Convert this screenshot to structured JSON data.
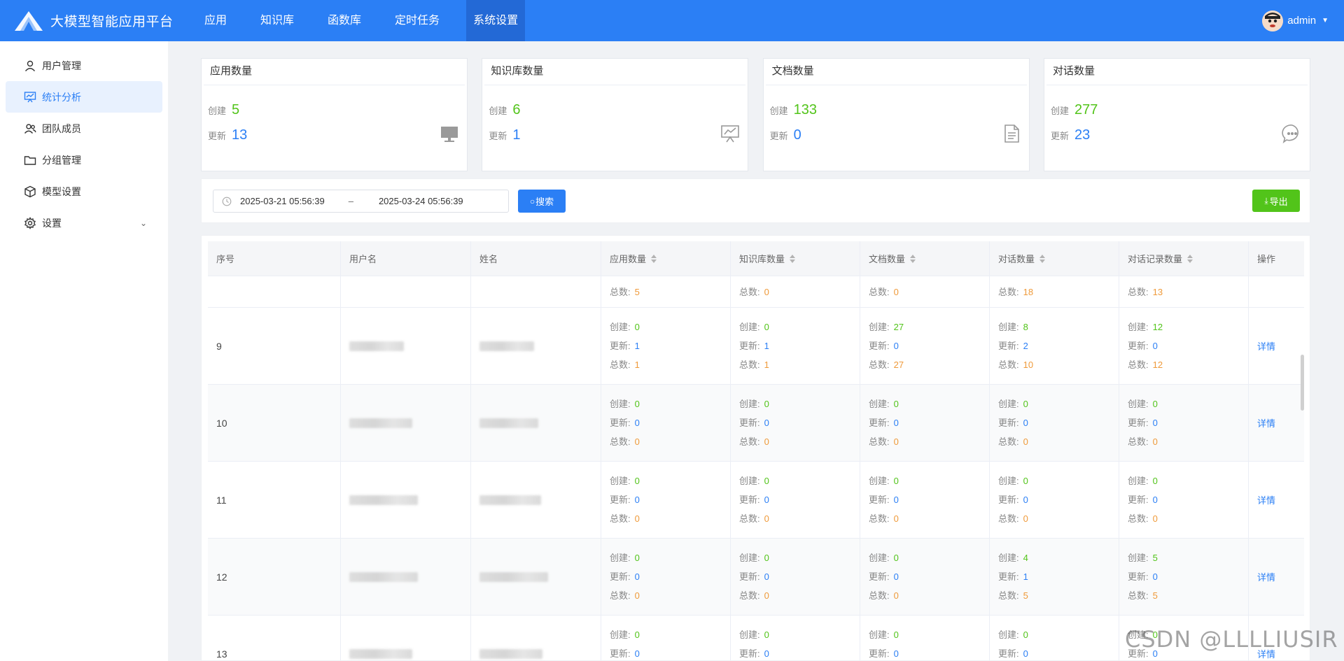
{
  "app": {
    "title": "大模型智能应用平台"
  },
  "nav": [
    {
      "label": "应用"
    },
    {
      "label": "知识库"
    },
    {
      "label": "函数库"
    },
    {
      "label": "定时任务"
    },
    {
      "label": "系统设置"
    }
  ],
  "user": {
    "name": "admin"
  },
  "sidebar": {
    "items": [
      {
        "label": "用户管理",
        "icon": "user-icon"
      },
      {
        "label": "统计分析",
        "icon": "chart-board-icon"
      },
      {
        "label": "团队成员",
        "icon": "team-icon"
      },
      {
        "label": "分组管理",
        "icon": "folder-icon"
      },
      {
        "label": "模型设置",
        "icon": "cube-icon"
      },
      {
        "label": "设置",
        "icon": "gear-icon"
      }
    ]
  },
  "colors": {
    "header": "#2b7ff5",
    "green": "#52c41a",
    "blue": "#2b7ff5",
    "orange": "#ef9a3a"
  },
  "labels": {
    "create": "创建",
    "update": "更新",
    "total": "总数:",
    "create_colon": "创建:",
    "update_colon": "更新:"
  },
  "cards": [
    {
      "title": "应用数量",
      "create": "5",
      "update": "13",
      "icon": "monitor-icon"
    },
    {
      "title": "知识库数量",
      "create": "6",
      "update": "1",
      "icon": "presentation-icon"
    },
    {
      "title": "文档数量",
      "create": "133",
      "update": "0",
      "icon": "document-icon"
    },
    {
      "title": "对话数量",
      "create": "277",
      "update": "23",
      "icon": "chat-icon"
    }
  ],
  "filter": {
    "start": "2025-03-21 05:56:39",
    "separator": "–",
    "end": "2025-03-24 05:56:39",
    "search_label": "搜索",
    "export_label": "导出"
  },
  "table": {
    "headers": [
      "序号",
      "用户名",
      "姓名",
      "应用数量",
      "知识库数量",
      "文档数量",
      "对话数量",
      "对话记录数量",
      "操作"
    ],
    "partial_totals": [
      "5",
      "0",
      "0",
      "18",
      "13"
    ],
    "rows": [
      {
        "index": "9",
        "create": [
          "0",
          "0",
          "27",
          "8",
          "12"
        ],
        "update": [
          "1",
          "1",
          "0",
          "2",
          "0"
        ],
        "total": [
          "1",
          "1",
          "27",
          "10",
          "12"
        ]
      },
      {
        "index": "10",
        "create": [
          "0",
          "0",
          "0",
          "0",
          "0"
        ],
        "update": [
          "0",
          "0",
          "0",
          "0",
          "0"
        ],
        "total": [
          "0",
          "0",
          "0",
          "0",
          "0"
        ]
      },
      {
        "index": "11",
        "create": [
          "0",
          "0",
          "0",
          "0",
          "0"
        ],
        "update": [
          "0",
          "0",
          "0",
          "0",
          "0"
        ],
        "total": [
          "0",
          "0",
          "0",
          "0",
          "0"
        ]
      },
      {
        "index": "12",
        "create": [
          "0",
          "0",
          "0",
          "4",
          "5"
        ],
        "update": [
          "0",
          "0",
          "0",
          "1",
          "0"
        ],
        "total": [
          "0",
          "0",
          "0",
          "5",
          "5"
        ]
      },
      {
        "index": "13",
        "create": [
          "0",
          "0",
          "0",
          "0",
          "0"
        ],
        "update": [
          "0",
          "0",
          "0",
          "0",
          "0"
        ],
        "total": [
          "",
          "",
          "",
          "",
          ""
        ]
      }
    ],
    "action_label": "详情"
  },
  "watermark": "CSDN @LLLLIUSIR"
}
